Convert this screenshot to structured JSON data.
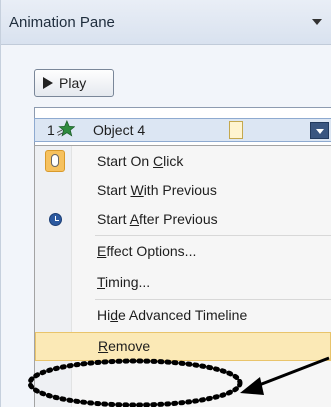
{
  "pane": {
    "title": "Animation Pane"
  },
  "play_button": {
    "label": "Play"
  },
  "animation_item": {
    "number": "1",
    "name": "Object 4"
  },
  "context_menu": {
    "items": [
      {
        "pre": "Start On ",
        "key": "C",
        "post": "lick",
        "icon": "mouse-click-icon"
      },
      {
        "pre": "Start ",
        "key": "W",
        "post": "ith Previous",
        "icon": ""
      },
      {
        "pre": "Start ",
        "key": "A",
        "post": "fter Previous",
        "icon": "clock-icon"
      },
      {
        "pre": "",
        "key": "E",
        "post": "ffect Options...",
        "icon": ""
      },
      {
        "pre": "",
        "key": "T",
        "post": "iming...",
        "icon": ""
      },
      {
        "pre": "Hi",
        "key": "d",
        "post": "e Advanced Timeline",
        "icon": ""
      },
      {
        "pre": "",
        "key": "R",
        "post": "emove",
        "icon": "",
        "highlighted": true
      }
    ]
  },
  "colors": {
    "highlight": "#fbe9b6",
    "annotation": "#000000"
  }
}
